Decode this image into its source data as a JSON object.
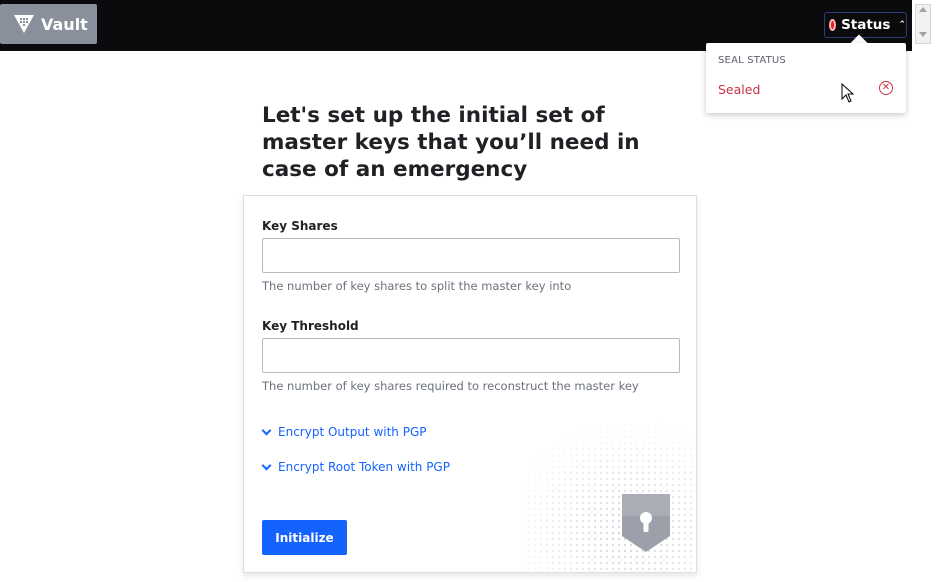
{
  "nav": {
    "brand_label": "Vault",
    "status_label": "Status",
    "status_color": "#e52228"
  },
  "seal_dropdown": {
    "heading": "SEAL STATUS",
    "value": "Sealed",
    "value_color": "#c73445"
  },
  "page": {
    "headline": "Let's set up the initial set of master keys that you’ll need in case of an emergency"
  },
  "form": {
    "key_shares": {
      "label": "Key Shares",
      "value": "",
      "help": "The number of key shares to split the master key into"
    },
    "key_threshold": {
      "label": "Key Threshold",
      "value": "",
      "help": "The number of key shares required to reconstruct the master key"
    },
    "toggles": [
      {
        "label": "Encrypt Output with PGP"
      },
      {
        "label": "Encrypt Root Token with PGP"
      }
    ],
    "submit_label": "Initialize",
    "accent_color": "#1563ff"
  }
}
